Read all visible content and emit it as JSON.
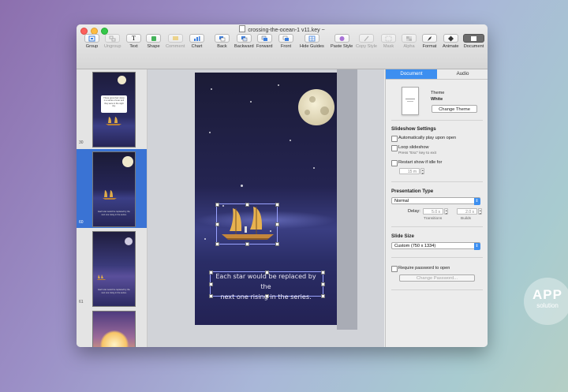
{
  "window": {
    "title": "crossing-the-ocean-1 v11.key",
    "title_suffix": "~"
  },
  "toolbar": {
    "group": "Group",
    "ungroup": "Ungroup",
    "text": "Text",
    "shape": "Shape",
    "comment": "Comment",
    "chart": "Chart",
    "back": "Back",
    "backward": "Backward",
    "forward": "Forward",
    "front": "Front",
    "hide_guides": "Hide Guides",
    "paste_style": "Paste Style",
    "copy_style": "Copy Style",
    "mask": "Mask",
    "alpha": "Alpha",
    "format": "Format",
    "animate": "Animate",
    "document": "Document"
  },
  "sidebar": {
    "slides": [
      {
        "number": "30",
        "text": "These grew their vision in a series of ever and they were in the night sky."
      },
      {
        "number": "60",
        "text": "Each star would be replaced by the next one rising in the series."
      },
      {
        "number": "61",
        "text": "Each star would be replaced by the next one rising in the series."
      },
      {
        "number": "",
        "text": ""
      }
    ]
  },
  "slide": {
    "caption_line1": "Each star would be replaced by the",
    "caption_line2": "next one rising in the series."
  },
  "inspector": {
    "tabs": {
      "document": "Document",
      "audio": "Audio"
    },
    "theme_label": "Theme",
    "theme_name": "White",
    "change_theme": "Change Theme",
    "slideshow_settings": "Slideshow Settings",
    "auto_play": "Automatically play upon open",
    "loop": "Loop slideshow",
    "loop_hint": "Press \"Esc\" key to exit",
    "restart": "Restart show if idle for",
    "restart_value": "15 m",
    "presentation_type": "Presentation Type",
    "presentation_value": "Normal",
    "delay_label": "Delay:",
    "transitions_value": "5.0 s",
    "builds_value": "2.0 s",
    "transitions_label": "Transitions",
    "builds_label": "Builds",
    "slide_size": "Slide Size",
    "slide_size_value": "Custom (750 x 1334)",
    "require_password": "Require password to open",
    "change_password": "Change Password..."
  },
  "watermark": {
    "line1": "APP",
    "line2": "solution"
  },
  "colors": {
    "accent": "#3d8ff0",
    "selected_slide": "#3a73d4"
  }
}
